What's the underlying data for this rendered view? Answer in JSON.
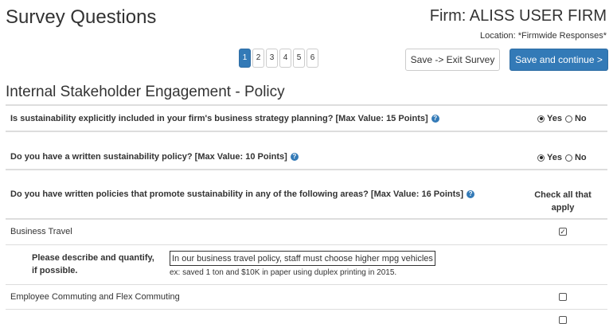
{
  "header": {
    "title": "Survey Questions",
    "firm": "Firm: ALISS USER FIRM",
    "location": "Location: *Firmwide Responses*"
  },
  "pagination": {
    "pages": [
      "1",
      "2",
      "3",
      "4",
      "5",
      "6"
    ],
    "active": 1
  },
  "actions": {
    "exit_label": "Save -> Exit Survey",
    "save_label": "Save and continue >"
  },
  "section": {
    "title": "Internal Stakeholder Engagement - Policy"
  },
  "questions": [
    {
      "text": "Is sustainability explicitly included in your firm's business strategy planning? [Max Value: 15 Points]",
      "answer": "Yes",
      "yes_label": "Yes",
      "no_label": "No"
    },
    {
      "text": "Do you have a written sustainability policy? [Max Value: 10 Points]",
      "answer": "Yes",
      "yes_label": "Yes",
      "no_label": "No"
    },
    {
      "text": "Do you have written policies that promote sustainability in any of the following areas? [Max Value: 16 Points]",
      "check_all_label": "Check all that apply"
    }
  ],
  "areas": [
    {
      "label": "Business Travel",
      "checked": true,
      "describe_label_line1": "Please describe and quantify,",
      "describe_label_line2": "if possible.",
      "describe_value": "In our business travel policy, staff must choose higher mpg vehicles",
      "example": "ex: saved 1 ton and $10K in paper using duplex printing in 2015."
    },
    {
      "label": "Employee Commuting and Flex Commuting",
      "checked": false
    }
  ],
  "icons": {
    "help": "question-circle-icon"
  },
  "colors": {
    "primary": "#337ab7",
    "divider": "#dddddd",
    "text": "#333333"
  }
}
